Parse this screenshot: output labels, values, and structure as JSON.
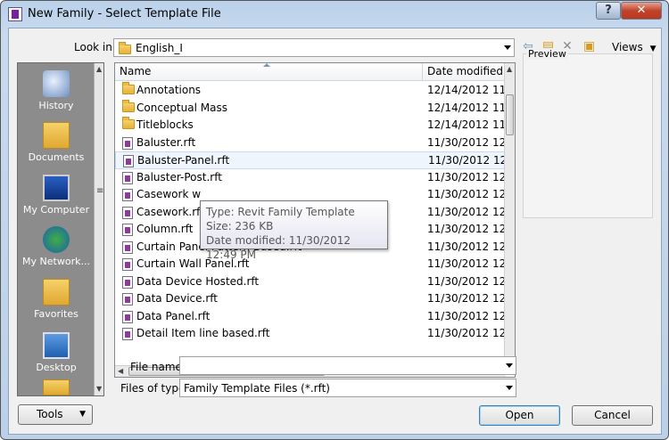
{
  "window": {
    "title": "New Family - Select Template File",
    "help_symbol": "?",
    "close_symbol": "✕"
  },
  "look_in": {
    "label": "Look in:",
    "value": "English_I"
  },
  "toolbar": {
    "icons": [
      "back-arrow-icon",
      "up-folder-icon",
      "delete-icon",
      "new-folder-icon"
    ],
    "views_label": "Views"
  },
  "places": [
    "History",
    "Documents",
    "My Computer",
    "My Network...",
    "Favorites",
    "Desktop"
  ],
  "columns": {
    "name": "Name",
    "date": "Date modified"
  },
  "files": [
    {
      "name": "Annotations",
      "type": "folder",
      "date": "12/14/2012 11:"
    },
    {
      "name": "Conceptual Mass",
      "type": "folder",
      "date": "12/14/2012 11:"
    },
    {
      "name": "Titleblocks",
      "type": "folder",
      "date": "12/14/2012 11:"
    },
    {
      "name": "Baluster.rft",
      "type": "rft",
      "date": "11/30/2012 12:"
    },
    {
      "name": "Baluster-Panel.rft",
      "type": "rft",
      "date": "11/30/2012 12:"
    },
    {
      "name": "Baluster-Post.rft",
      "type": "rft",
      "date": "11/30/2012 12:"
    },
    {
      "name": "Casework w",
      "type": "rft",
      "date": "11/30/2012 12:"
    },
    {
      "name": "Casework.rft",
      "type": "rft",
      "date": "11/30/2012 12:"
    },
    {
      "name": "Column.rft",
      "type": "rft",
      "date": "11/30/2012 12:"
    },
    {
      "name": "Curtain Panel Pattern Based.rft",
      "type": "rft",
      "date": "11/30/2012 12:"
    },
    {
      "name": "Curtain Wall Panel.rft",
      "type": "rft",
      "date": "11/30/2012 12:"
    },
    {
      "name": "Data Device Hosted.rft",
      "type": "rft",
      "date": "11/30/2012 12:"
    },
    {
      "name": "Data Device.rft",
      "type": "rft",
      "date": "11/30/2012 12:"
    },
    {
      "name": "Data Panel.rft",
      "type": "rft",
      "date": "11/30/2012 12:"
    },
    {
      "name": "Detail Item line based.rft",
      "type": "rft",
      "date": "11/30/2012 12:"
    }
  ],
  "tooltip": {
    "type": "Type: Revit Family Template",
    "size": "Size: 236 KB",
    "modified": "Date modified: 11/30/2012 12:49 PM"
  },
  "preview_label": "Preview",
  "file_name": {
    "label": "File name:",
    "value": ""
  },
  "file_type": {
    "label": "Files of type:",
    "value": "Family Template Files  (*.rft)"
  },
  "buttons": {
    "tools": "Tools",
    "open": "Open",
    "cancel": "Cancel"
  }
}
